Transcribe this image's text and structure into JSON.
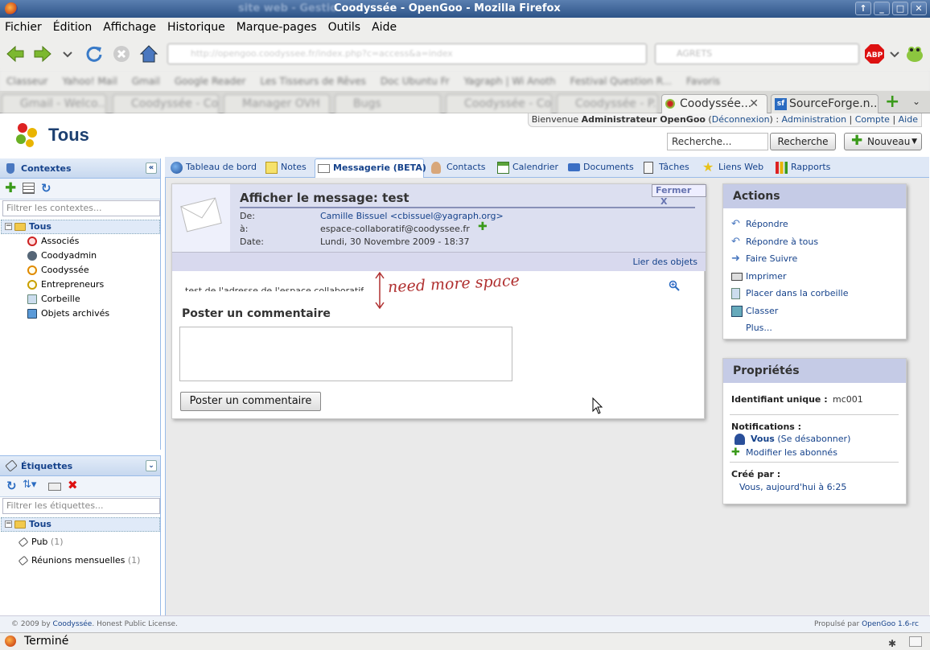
{
  "window": {
    "title": "Coodyssée - OpenGoo - Mozilla Firefox",
    "title_left_blurred": "site web - Gestio"
  },
  "menu": [
    "Fichier",
    "Édition",
    "Affichage",
    "Historique",
    "Marque-pages",
    "Outils",
    "Aide"
  ],
  "browser_tabs": [
    {
      "label": "Coodyssée...",
      "active": true
    },
    {
      "label": "SourceForge.n...",
      "active": false
    }
  ],
  "app": {
    "title": "Tous",
    "userbar": {
      "welcome": "Bienvenue",
      "user": "Administrateur OpenGoo",
      "logout": "Déconnexion",
      "admin": "Administration",
      "account": "Compte",
      "help": "Aide"
    },
    "search_placeholder": "Recherche...",
    "search_button": "Recherche",
    "new_button": "Nouveau"
  },
  "contexts": {
    "header": "Contextes",
    "filter_placeholder": "Filtrer les contextes...",
    "root": "Tous",
    "items": [
      {
        "label": "Associés",
        "color": "#cc2222"
      },
      {
        "label": "Coodyadmin",
        "color": "#556677"
      },
      {
        "label": "Coodyssée",
        "color": "#e08a00"
      },
      {
        "label": "Entrepreneurs",
        "color": "#c9a000"
      },
      {
        "label": "Corbeille",
        "icon": "trash-icon"
      },
      {
        "label": "Objets archivés",
        "icon": "archive-icon"
      }
    ]
  },
  "tags": {
    "header": "Étiquettes",
    "filter_placeholder": "Filtrer les étiquettes...",
    "root": "Tous",
    "items": [
      {
        "label": "Pub",
        "count": "(1)"
      },
      {
        "label": "Réunions mensuelles",
        "count": "(1)"
      }
    ]
  },
  "app_tabs": [
    "Tableau de bord",
    "Notes",
    "Messagerie (BETA)",
    "Contacts",
    "Calendrier",
    "Documents",
    "Tâches",
    "Liens Web",
    "Rapports"
  ],
  "message": {
    "title": "Afficher le message: test",
    "close": "Fermer",
    "from_label": "De:",
    "from": "Camille Bissuel <cbissuel@yagraph.org>",
    "to_label": "à:",
    "to": "espace-collaboratif@coodyssee.fr",
    "date_label": "Date:",
    "date": "Lundi, 30 Novembre 2009 - 18:37",
    "link_objects": "Lier des objets",
    "body": "test de l'adresse de l'espace collaboratif",
    "handwritten_note": "need more space",
    "comment_heading": "Poster un commentaire",
    "comment_button": "Poster un commentaire"
  },
  "actions": {
    "header": "Actions",
    "items": [
      "Répondre",
      "Répondre à tous",
      "Faire Suivre",
      "Imprimer",
      "Placer dans la corbeille",
      "Classer",
      "Plus..."
    ]
  },
  "properties": {
    "header": "Propriétés",
    "id_label": "Identifiant unique :",
    "id_value": "mc001",
    "notifications_label": "Notifications :",
    "you": "Vous",
    "unsubscribe": "(Se désabonner)",
    "modify_subscribers": "Modifier les abonnés",
    "created_label": "Créé par :",
    "created_value": "Vous, aujourd'hui à 6:25"
  },
  "footer": {
    "left_prefix": "© 2009 by",
    "left_link": "Coodyssée",
    "left_suffix": ". Honest Public License.",
    "right_prefix": "Propulsé par",
    "right_link": "OpenGoo 1.6-rc"
  },
  "status": "Terminé"
}
